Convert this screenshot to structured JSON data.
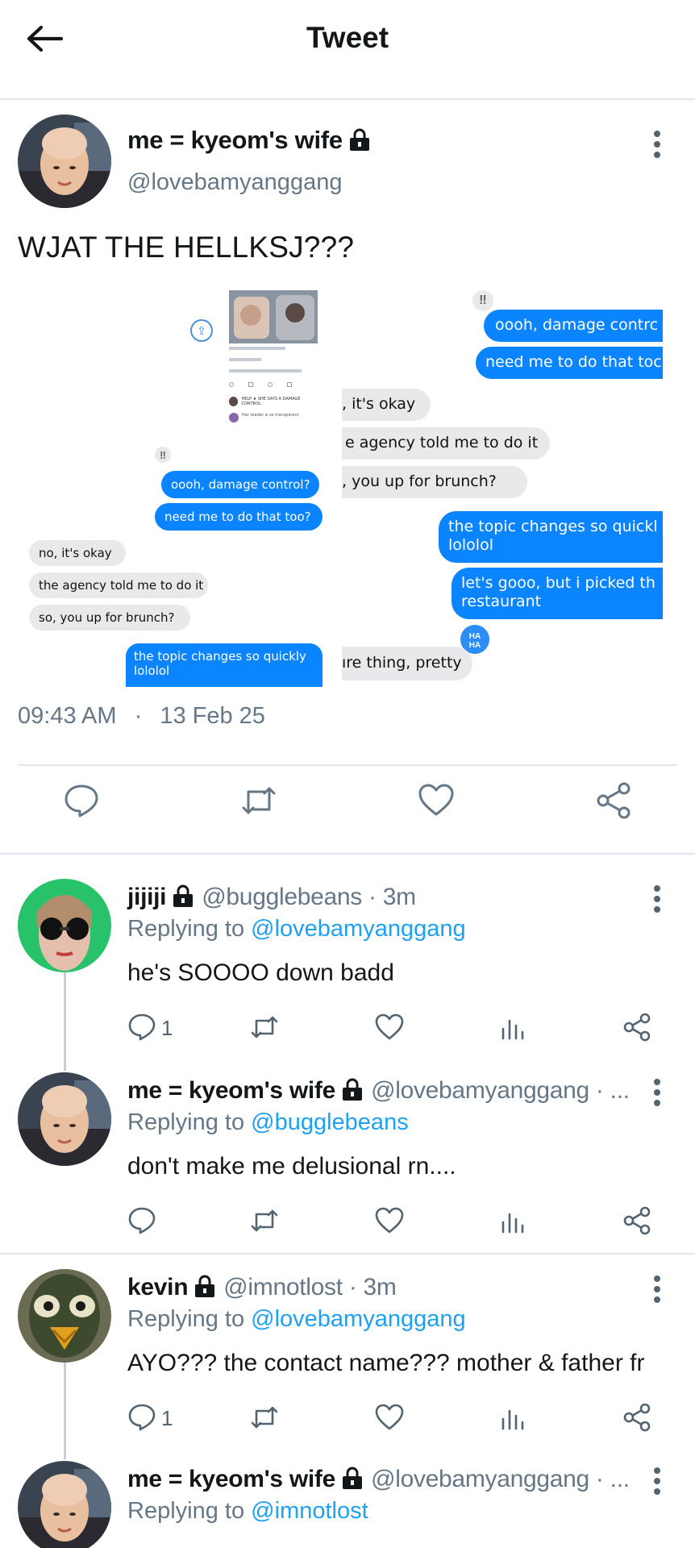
{
  "header": {
    "title": "Tweet",
    "back_icon": "arrow-left-icon"
  },
  "main_tweet": {
    "display_name": "me = kyeom's wife",
    "handle": "@lovebamyanggang",
    "text": "WJAT THE HELLKSJ???",
    "time": "09:43 AM",
    "separator": "·",
    "date": "13 Feb 25",
    "embedded_chat": {
      "right_column": {
        "blue_bubbles": [
          "oooh, damage contrc",
          "need me to do that toc"
        ],
        "grey_bubbles": [
          ", it's okay",
          "e agency told me to do it",
          ", you up for brunch?"
        ],
        "blue_bubbles_2": [
          "the topic changes so quickl\nlololol",
          "let's gooo, but i picked th\nrestaurant"
        ],
        "reaction_badge": "HA\nHA",
        "last_grey": "ıre thing, pretty"
      },
      "left_column": {
        "stamp": "‼",
        "blue_bubbles": [
          "oooh, damage control?",
          "need me to do that too?"
        ],
        "grey_bubbles": [
          "no, it's okay",
          "the agency told me to do it",
          "so, you up for brunch?"
        ],
        "last_blue": "the topic changes so quickly\nlololol"
      },
      "thumbnail_rows": [
        "HELP ★ SHE SAYS A DAMAGE CONTROL",
        "Her reader is so transparent"
      ]
    },
    "colors": {
      "imessage_blue": "#0a84ff",
      "imessage_grey": "#e9e9eb",
      "link_blue": "#1da1f2"
    }
  },
  "replies": [
    {
      "display_name": "jijiji",
      "handle": "@bugglebeans",
      "time": "· 3m",
      "replying_prefix": "Replying to",
      "replying_to": "@lovebamyanggang",
      "text": "he's SOOOO down badd",
      "reply_count": "1"
    },
    {
      "display_name": "me = kyeom's wife",
      "handle": "@lovebamyanggang · ...",
      "replying_prefix": "Replying to",
      "replying_to": "@bugglebeans",
      "text": "don't make me delusional rn....",
      "reply_count": ""
    },
    {
      "display_name": "kevin",
      "handle": "@imnotlost",
      "time": "· 3m",
      "replying_prefix": "Replying to",
      "replying_to": "@lovebamyanggang",
      "text": "AYO??? the contact name??? mother & father fr",
      "reply_count": "1"
    },
    {
      "display_name": "me = kyeom's wife",
      "handle": "@lovebamyanggang · ...",
      "replying_prefix": "Replying to",
      "replying_to": "@imnotlost",
      "text": "",
      "reply_count": ""
    }
  ],
  "icons": [
    "reply-icon",
    "retweet-icon",
    "like-icon",
    "share-icon",
    "analytics-icon",
    "lock-icon",
    "more-icon"
  ]
}
